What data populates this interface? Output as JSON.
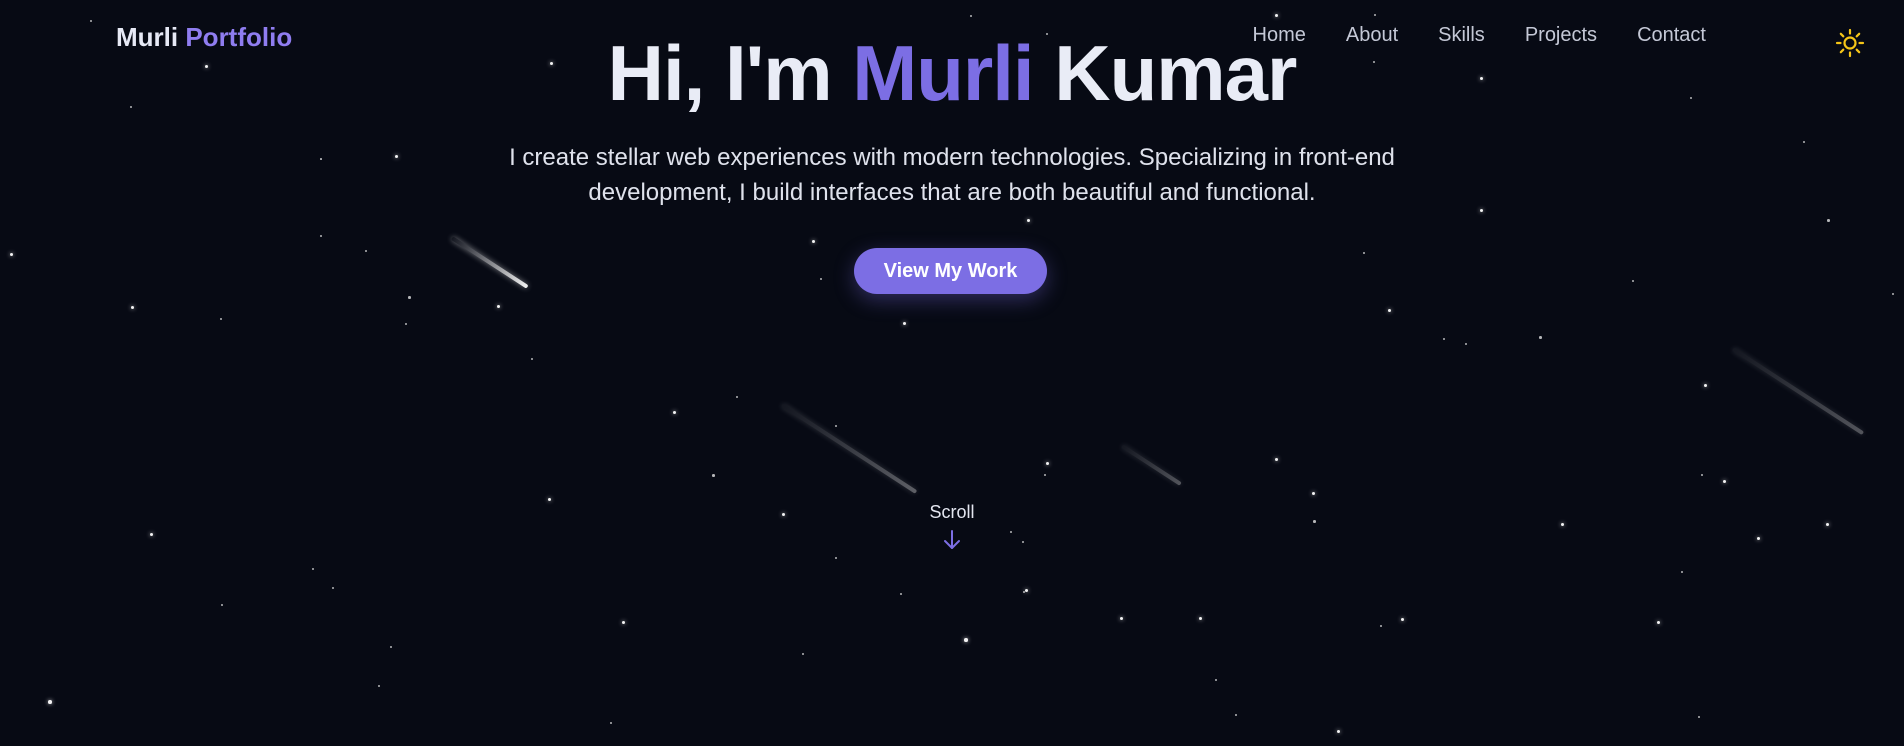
{
  "logo": {
    "primary": "Murli",
    "accent": "Portfolio"
  },
  "nav": {
    "items": [
      {
        "label": "Home"
      },
      {
        "label": "About"
      },
      {
        "label": "Skills"
      },
      {
        "label": "Projects"
      },
      {
        "label": "Contact"
      }
    ],
    "theme_toggle_icon": "sun-icon"
  },
  "hero": {
    "greeting": "Hi, I'm",
    "first_name": "Murli",
    "last_name": "Kumar",
    "description": "I create stellar web experiences with modern technologies. Specializing in front-end development, I build interfaces that are both beautiful and functional.",
    "cta_label": "View My Work"
  },
  "scroll": {
    "label": "Scroll",
    "icon": "arrow-down-icon"
  },
  "colors": {
    "background": "#070a14",
    "accent": "#7c6ee4",
    "logo_accent": "#8f7df0",
    "text": "#e9ecf6",
    "nav_text": "#c4c8d6",
    "sun_icon": "#f5c518"
  }
}
